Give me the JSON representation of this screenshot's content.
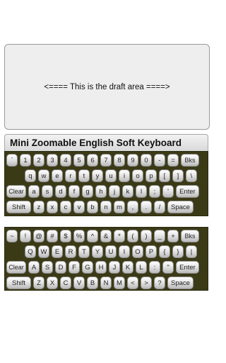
{
  "draft": {
    "text": "<==== This is the draft area ====>"
  },
  "keyboard": {
    "title": "Mini Zoomable English Soft Keyboard"
  },
  "lower": {
    "row1": [
      "`",
      "1",
      "2",
      "3",
      "4",
      "5",
      "6",
      "7",
      "8",
      "9",
      "0",
      "-",
      "=",
      "Bks"
    ],
    "row2": [
      "q",
      "w",
      "e",
      "r",
      "t",
      "y",
      "u",
      "i",
      "o",
      "p",
      "[",
      "]",
      "\\"
    ],
    "row3": [
      "Clear",
      "a",
      "s",
      "d",
      "f",
      "g",
      "h",
      "j",
      "k",
      "l",
      ";",
      "'",
      "Enter"
    ],
    "row4": [
      "Shift",
      "z",
      "x",
      "c",
      "v",
      "b",
      "n",
      "m",
      ",",
      ".",
      "/",
      "Space"
    ]
  },
  "upper": {
    "row1": [
      "~",
      "!",
      "@",
      "#",
      "$",
      "%",
      "^",
      "&",
      "*",
      "(",
      ")",
      "_",
      "+",
      "Bks"
    ],
    "row2": [
      "Q",
      "W",
      "E",
      "R",
      "T",
      "Y",
      "U",
      "I",
      "O",
      "P",
      "{",
      "}",
      "|"
    ],
    "row3": [
      "Clear",
      "A",
      "S",
      "D",
      "F",
      "G",
      "H",
      "J",
      "K",
      "L",
      ":",
      "\"",
      "Enter"
    ],
    "row4": [
      "Shift",
      "Z",
      "X",
      "C",
      "V",
      "B",
      "N",
      "M",
      "<",
      ">",
      "?",
      "Space"
    ]
  }
}
